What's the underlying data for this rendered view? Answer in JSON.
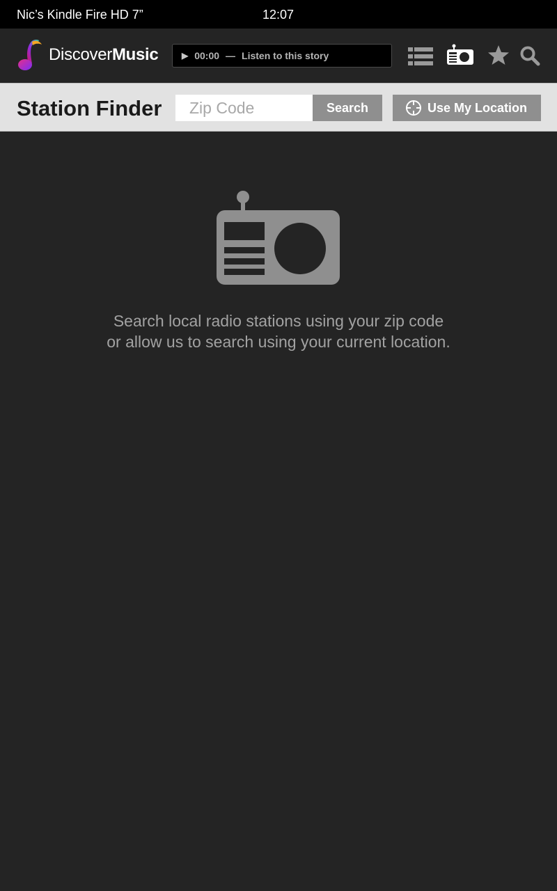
{
  "status_bar": {
    "device_name": "Nic’s Kindle Fire HD 7”",
    "time": "12:07"
  },
  "app_bar": {
    "logo": {
      "text_light": "Discover",
      "text_bold": "Music"
    },
    "player": {
      "play_icon": "play-icon",
      "time": "00:00",
      "separator": "—",
      "label": "Listen to this story"
    },
    "nav_icons": [
      "list-icon",
      "radio-icon",
      "star-icon",
      "search-icon"
    ]
  },
  "finder": {
    "title": "Station Finder",
    "zip_placeholder": "Zip Code",
    "zip_value": "",
    "search_label": "Search",
    "location_label": "Use My Location",
    "location_icon": "crosshair-icon"
  },
  "empty_state": {
    "icon": "radio-icon",
    "line1": "Search local radio stations using your zip code",
    "line2": "or allow us to search using your current location."
  },
  "colors": {
    "background": "#242424",
    "status_bar": "#000000",
    "finder_bar": "#e2e2e2",
    "button": "#8f8f8f",
    "icon_gray": "#9a9a9a",
    "message_text": "#a2a2a2"
  }
}
